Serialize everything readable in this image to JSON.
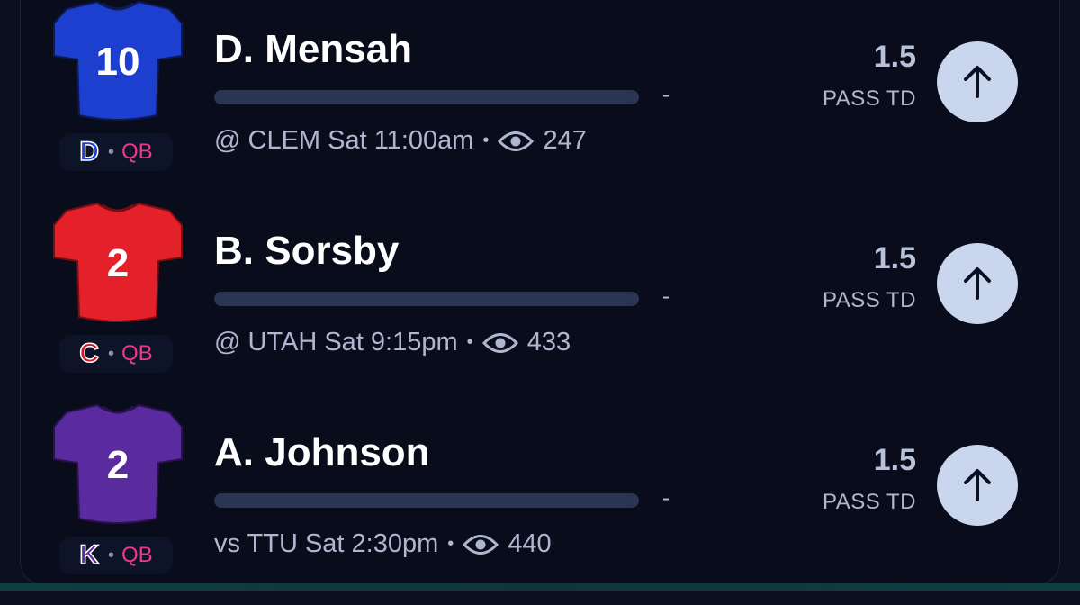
{
  "colors": {
    "background": "#090d1b",
    "pos_pink": "#ec3a86",
    "bar_track": "#2a3553",
    "button": "#c9d6ee"
  },
  "players": [
    {
      "name": "D. Mensah",
      "jersey_number": "10",
      "jersey_color": "#1d3fd0",
      "team_letter": "D",
      "team_color": "#1a3ee0",
      "position": "QB",
      "bar_dash": "-",
      "matchup": "@ CLEM Sat 11:00am",
      "views": "247",
      "line": "1.5",
      "stat": "PASS TD",
      "icon": "arrow-up-icon"
    },
    {
      "name": "B. Sorsby",
      "jersey_number": "2",
      "jersey_color": "#e4212b",
      "team_letter": "C",
      "team_color": "#d6141e",
      "position": "QB",
      "bar_dash": "-",
      "matchup": "@ UTAH Sat 9:15pm",
      "views": "433",
      "line": "1.5",
      "stat": "PASS TD",
      "icon": "arrow-up-icon"
    },
    {
      "name": "A. Johnson",
      "jersey_number": "2",
      "jersey_color": "#5a2b9e",
      "team_letter": "K",
      "team_color": "#5b2aa0",
      "position": "QB",
      "bar_dash": "-",
      "matchup": "vs TTU Sat 2:30pm",
      "views": "440",
      "line": "1.5",
      "stat": "PASS TD",
      "icon": "arrow-up-icon"
    }
  ]
}
